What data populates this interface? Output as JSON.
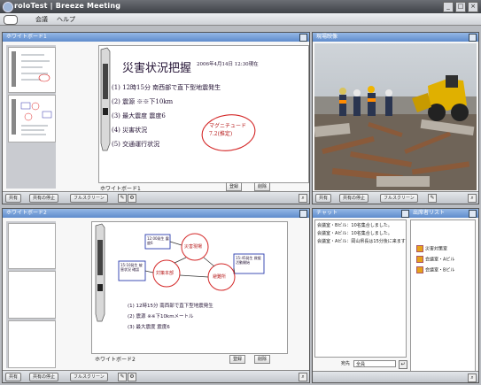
{
  "window": {
    "title": "roloTest | Breeze Meeting",
    "min": "_",
    "max": "□",
    "close": "×"
  },
  "menu": {
    "items": [
      "会議",
      "ヘルプ"
    ]
  },
  "pods": {
    "whiteboard1": {
      "title": "ホワイトボード1",
      "label": "ホワイトボード1",
      "register": "登録",
      "delete": "削除",
      "handwriting": {
        "heading": "災害状況把握",
        "date": "2006年4月14日 12:30現在",
        "lines": [
          "(1) 12時15分  南西部で直下型地震発生",
          "(2) 震源  ※※下10km",
          "(3) 最大震度  震度6",
          "(4) 災害状況",
          "(5) 交通運行状況"
        ],
        "note": "マグニチュード 7.2(推定)"
      }
    },
    "camera": {
      "title": "現場映像"
    },
    "whiteboard2": {
      "title": "ホワイトボード2",
      "label": "ホワイトボード2",
      "register": "登録",
      "delete": "削除",
      "nodes": [
        "12:00発生 震度6",
        "災害現場",
        "15:10発生 被害状況 確認",
        "15:45発生 救援活動開始",
        "対策本部",
        "避難所"
      ],
      "lines": [
        "(1) 12時15分 南西部で直下型地震発生",
        "(2) 震源  ※※下10kmメートル",
        "(3) 最大震度  震度6"
      ]
    },
    "chat": {
      "title": "チャット",
      "messages": [
        "会議室・Bビル：10名集合しました。",
        "会議室・Aビル：10名集合しました。",
        "会議室・Aビル：岡山県長は15分後に来ます"
      ],
      "to_label": "宛先",
      "to_value": "全員"
    },
    "attendees": {
      "title": "出席者リスト",
      "users": [
        "災害対策室",
        "会議室・Aビル",
        "会議室・Bビル"
      ]
    }
  },
  "toolbar": {
    "share": "共有",
    "stop_share": "共有の停止",
    "fullscreen": "フルスクリーン"
  }
}
